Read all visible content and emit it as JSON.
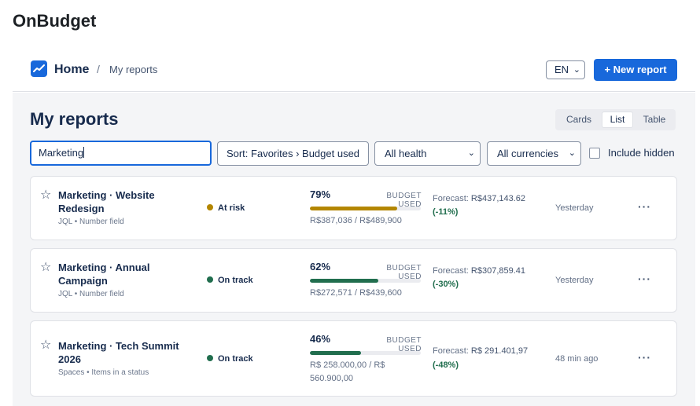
{
  "app": {
    "title": "OnBudget"
  },
  "breadcrumb": {
    "home": "Home",
    "separator": "/",
    "current": "My reports"
  },
  "language": {
    "selected": "EN"
  },
  "header": {
    "new_report_label": "+ New report"
  },
  "page": {
    "title": "My reports"
  },
  "view_modes": {
    "options": [
      "Cards",
      "List",
      "Table"
    ],
    "selected": "List"
  },
  "filters": {
    "search_value": "Marketing",
    "sort_label": "Sort: Favorites › Budget used",
    "health_selected": "All health",
    "currency_selected": "All currencies",
    "include_hidden_label": "Include hidden",
    "include_hidden_checked": false
  },
  "reports": [
    {
      "title": "Marketing · Website Redesign",
      "meta": "JQL • Number field",
      "health": "At risk",
      "health_color": "#b38600",
      "percent_label": "79%",
      "percent": 79,
      "budget_label": "BUDGET USED",
      "bar_color": "#b38600",
      "amount": "R$387,036 / R$489,900",
      "forecast_label": "Forecast:",
      "forecast_value": "R$437,143.62",
      "delta": "(-11%)",
      "updated": "Yesterday"
    },
    {
      "title": "Marketing · Annual Campaign",
      "meta": "JQL • Number field",
      "health": "On track",
      "health_color": "#216e4e",
      "percent_label": "62%",
      "percent": 62,
      "budget_label": "BUDGET USED",
      "bar_color": "#216e4e",
      "amount": "R$272,571 / R$439,600",
      "forecast_label": "Forecast:",
      "forecast_value": "R$307,859.41",
      "delta": "(-30%)",
      "updated": "Yesterday"
    },
    {
      "title": "Marketing · Tech Summit 2026",
      "meta": "Spaces • Items in a status",
      "health": "On track",
      "health_color": "#216e4e",
      "percent_label": "46%",
      "percent": 46,
      "budget_label": "BUDGET USED",
      "bar_color": "#216e4e",
      "amount": "R$ 258.000,00 / R$ 560.900,00",
      "forecast_label": "Forecast:",
      "forecast_value": "R$ 291.401,97",
      "delta": "(-48%)",
      "updated": "48 min ago"
    }
  ],
  "more_glyph": "···",
  "star_glyph": "☆"
}
